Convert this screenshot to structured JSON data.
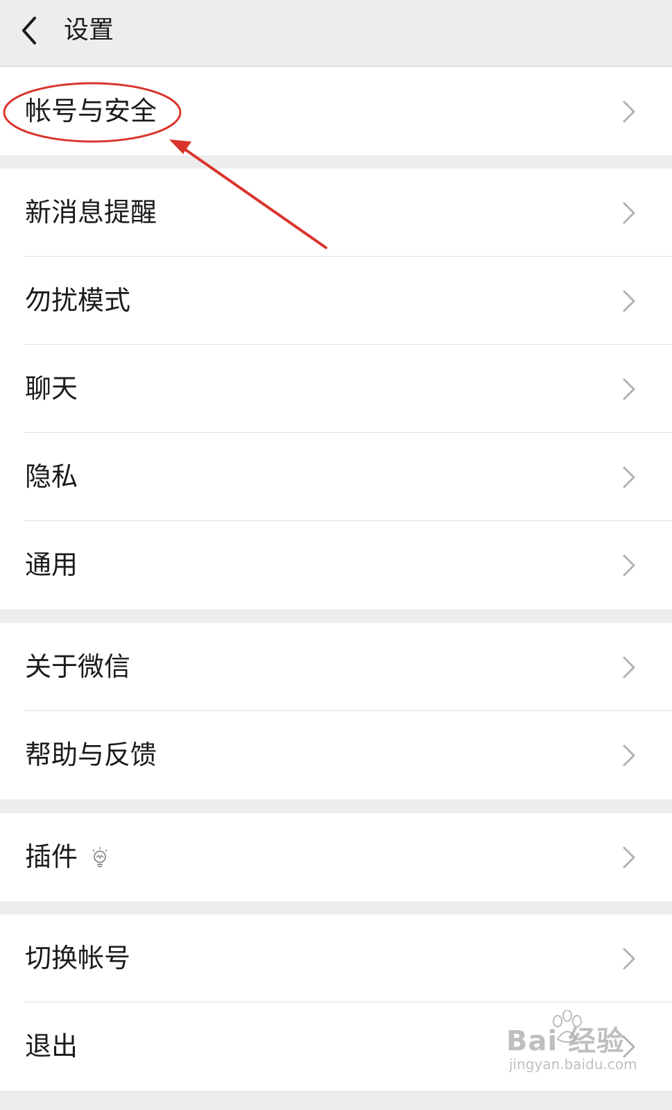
{
  "header": {
    "title": "设置",
    "back_icon": "chevron-left-icon"
  },
  "groups": [
    {
      "items": [
        {
          "label": "帐号与安全"
        }
      ]
    },
    {
      "items": [
        {
          "label": "新消息提醒"
        },
        {
          "label": "勿扰模式"
        },
        {
          "label": "聊天"
        },
        {
          "label": "隐私"
        },
        {
          "label": "通用"
        }
      ]
    },
    {
      "items": [
        {
          "label": "关于微信"
        },
        {
          "label": "帮助与反馈"
        }
      ]
    },
    {
      "items": [
        {
          "label": "插件",
          "badge_icon": "lightbulb-icon"
        }
      ]
    },
    {
      "items": [
        {
          "label": "切换帐号"
        },
        {
          "label": "退出"
        }
      ]
    }
  ],
  "annotation": {
    "color": "#d9342b",
    "shapes": [
      "ellipse",
      "arrow"
    ]
  },
  "watermark": {
    "brand": "Bai 经验",
    "url": "jingyan.baidu.com"
  },
  "colors": {
    "background": "#ededed",
    "row_background": "#ffffff",
    "text": "#1b1b1b",
    "chevron": "#b2b2b2"
  }
}
